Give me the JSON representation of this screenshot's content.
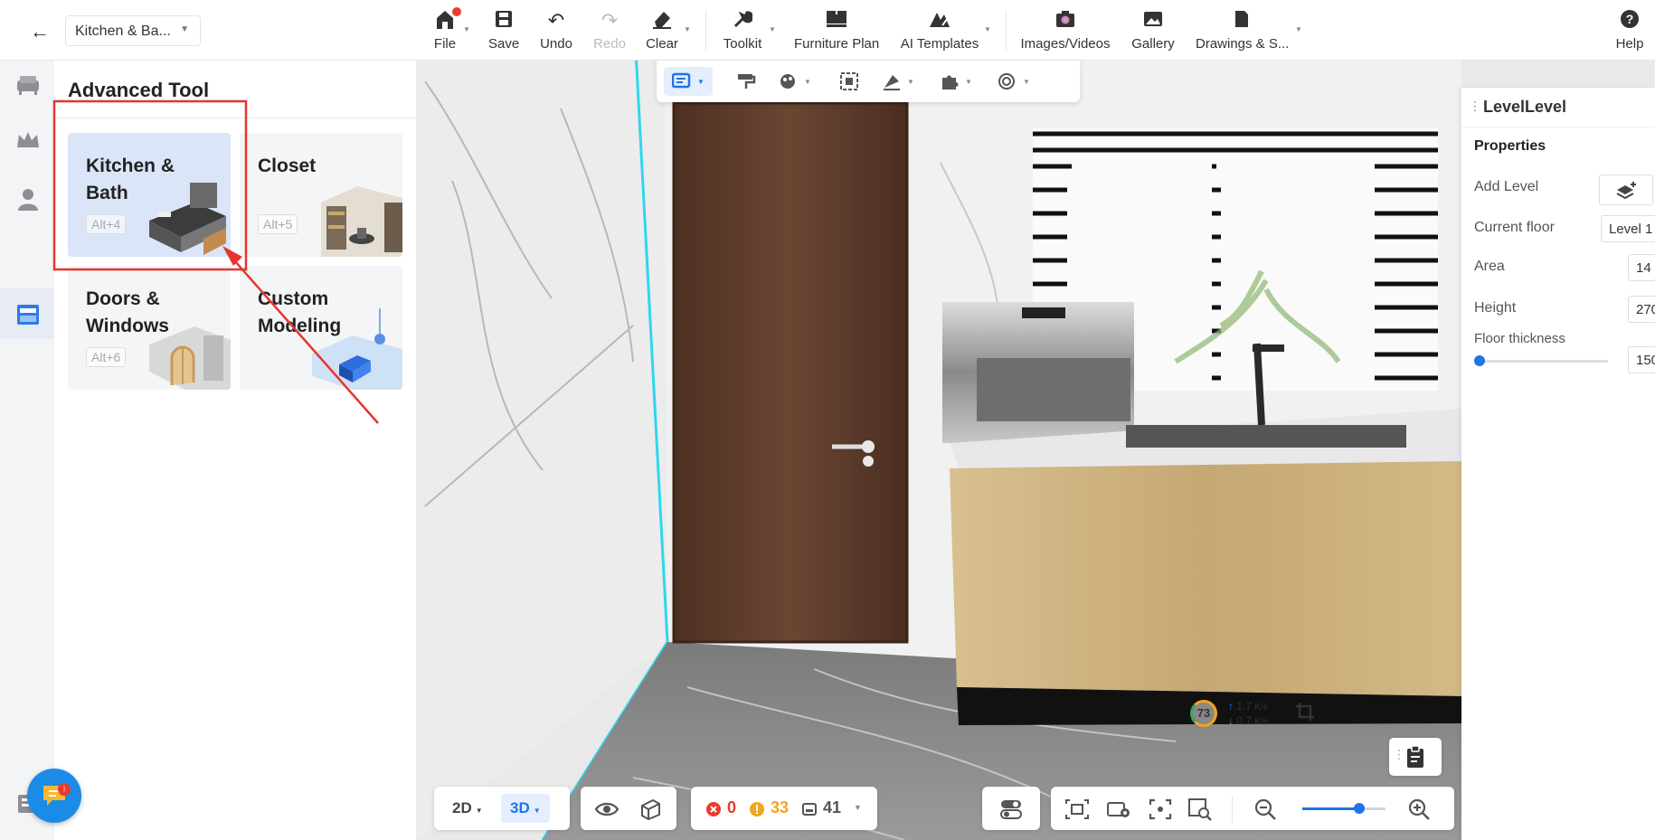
{
  "header": {
    "back_icon": "arrow-left-icon",
    "project_name": "Kitchen & Ba...",
    "items": [
      {
        "label": "File",
        "icon": "home-icon",
        "has_dot": true
      },
      {
        "label": "Save",
        "icon": "save-icon"
      },
      {
        "label": "Undo",
        "icon": "undo-icon"
      },
      {
        "label": "Redo",
        "icon": "redo-icon",
        "disabled": true
      },
      {
        "label": "Clear",
        "icon": "eraser-icon"
      },
      {
        "label": "Toolkit",
        "icon": "wrench-icon"
      },
      {
        "label": "Furniture Plan",
        "icon": "sofa-plan-icon"
      },
      {
        "label": "AI Templates",
        "icon": "ai-icon"
      },
      {
        "label": "Images/Videos",
        "icon": "camera-icon"
      },
      {
        "label": "Gallery",
        "icon": "gallery-icon"
      },
      {
        "label": "Drawings & S...",
        "icon": "document-icon"
      },
      {
        "label": "Help",
        "icon": "help-icon"
      }
    ]
  },
  "panel": {
    "title": "Advanced Tool",
    "tools": [
      {
        "name": "Kitchen &\nBath",
        "hotkey": "Alt+4",
        "selected": true
      },
      {
        "name": "Closet",
        "hotkey": "Alt+5"
      },
      {
        "name": "Doors &\nWindows",
        "hotkey": "Alt+6"
      },
      {
        "name": "Custom\nModeling",
        "hotkey": ""
      }
    ]
  },
  "properties": {
    "header": "LevelLevel",
    "section": "Properties",
    "add_level_label": "Add Level",
    "current_floor_label": "Current floor",
    "current_floor_value": "Level 1",
    "area_label": "Area",
    "area_value": "14",
    "height_label": "Height",
    "height_value": "270",
    "floor_thickness_label": "Floor thickness",
    "floor_thickness_value": "150"
  },
  "bottom": {
    "view_2d": "2D",
    "view_3d": "3D",
    "active_view": "3D",
    "errors": "0",
    "warnings": "33",
    "items": "41"
  },
  "perf": {
    "score": "73",
    "up": "1.7",
    "down": "0.7",
    "unit": "K/s"
  },
  "colors": {
    "accent": "#1f74e8",
    "annotation": "#e8342e",
    "selection_wall_edge": "#2fd6ee",
    "door": "#5a3b2c",
    "cabinet": "#c9ae7e"
  }
}
